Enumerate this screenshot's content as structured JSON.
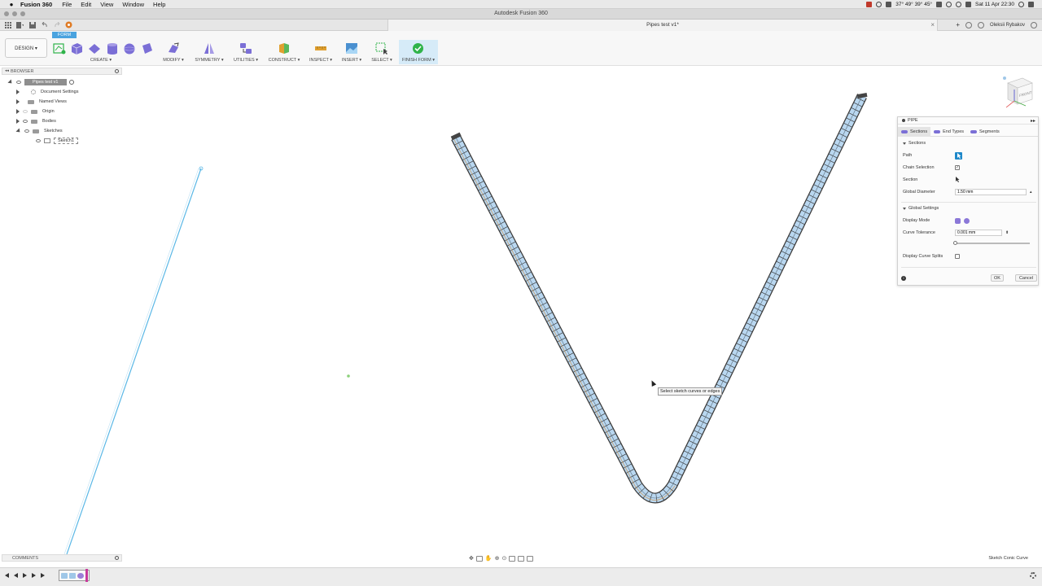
{
  "menubar": {
    "app_name": "Fusion 360",
    "items": [
      "File",
      "Edit",
      "View",
      "Window",
      "Help"
    ],
    "status_text": "37° 49° 39° 45°",
    "datetime": "Sat 11 Apr  22:30"
  },
  "window": {
    "title": "Autodesk Fusion 360"
  },
  "doc_tab": {
    "title": "Pipes test v1*",
    "user": "Oleksii Rybakov"
  },
  "toolbar": {
    "workspace": "DESIGN ▾",
    "active_tab": "FORM",
    "groups": [
      {
        "label": "CREATE ▾"
      },
      {
        "label": "MODIFY ▾"
      },
      {
        "label": "SYMMETRY ▾"
      },
      {
        "label": "UTILITIES ▾"
      },
      {
        "label": "CONSTRUCT ▾"
      },
      {
        "label": "INSPECT ▾"
      },
      {
        "label": "INSERT ▾"
      },
      {
        "label": "SELECT ▾"
      },
      {
        "label": "FINISH FORM ▾"
      }
    ],
    "accent_color": "#4aa3df",
    "finish_color": "#2fb34a"
  },
  "browser": {
    "title": "BROWSER",
    "root": "Pipes test v1",
    "items": [
      {
        "label": "Document Settings"
      },
      {
        "label": "Named Views"
      },
      {
        "label": "Origin"
      },
      {
        "label": "Bodies"
      },
      {
        "label": "Sketches"
      },
      {
        "label": "Sketch1"
      }
    ]
  },
  "pipe_dialog": {
    "title": "PIPE",
    "tabs": [
      "Sections",
      "End Types",
      "Segments"
    ],
    "sections_title": "Sections",
    "path_label": "Path",
    "chain_selection_label": "Chain Selection",
    "section_label": "Section",
    "global_diameter_label": "Global Diameter",
    "global_diameter_value": "1.50 mm",
    "global_settings_title": "Global Settings",
    "display_mode_label": "Display Mode",
    "curve_tolerance_label": "Curve Tolerance",
    "curve_tolerance_value": "0.001 mm",
    "display_curve_splits_label": "Display Curve Splits",
    "ok_label": "OK",
    "cancel_label": "Cancel",
    "chain_selection_checked": true,
    "display_curve_splits_checked": false,
    "curve_tolerance_slider": 0.0
  },
  "viewcube": {
    "face_label": "FRONT"
  },
  "tooltip": {
    "text": "Select sketch curves or edges"
  },
  "comments": {
    "title": "COMMENTS"
  },
  "status_bar": {
    "selection_info": "Sketch Conic Curve"
  },
  "colors": {
    "pipe_fill": "#b9d7f0",
    "pipe_edge": "#3a3a3a",
    "sketch_line": "#5bb8e6",
    "selection_blue": "#1e88c9"
  }
}
